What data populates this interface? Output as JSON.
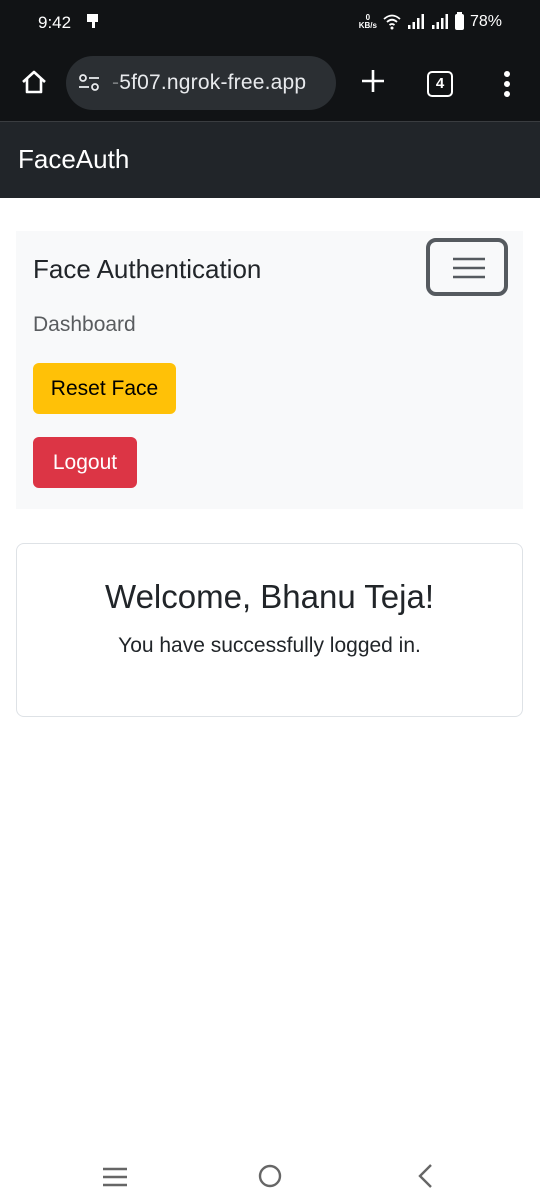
{
  "status_bar": {
    "time": "9:42",
    "network_speed_value": "0",
    "network_speed_unit": "KB/s",
    "battery": "78%"
  },
  "browser": {
    "url_prefix": "-",
    "url": "5f07.ngrok-free.app",
    "tab_count": "4"
  },
  "navbar": {
    "brand": "FaceAuth"
  },
  "nav_panel": {
    "title": "Face Authentication",
    "links": [
      "Dashboard"
    ],
    "reset_button": "Reset Face",
    "logout_button": "Logout"
  },
  "card": {
    "title": "Welcome, Bhanu Teja!",
    "text": "You have successfully logged in."
  },
  "colors": {
    "navbar_bg": "#212529",
    "warning": "#ffc107",
    "danger": "#dc3545",
    "panel_bg": "#f8f9fa"
  },
  "icons": [
    "home-icon",
    "tune-icon",
    "plus-icon",
    "tabs-icon",
    "more-vert-icon",
    "hamburger-icon",
    "recent-apps-icon",
    "home-circle-icon",
    "back-icon",
    "wifi-icon",
    "signal-icon",
    "battery-icon"
  ]
}
